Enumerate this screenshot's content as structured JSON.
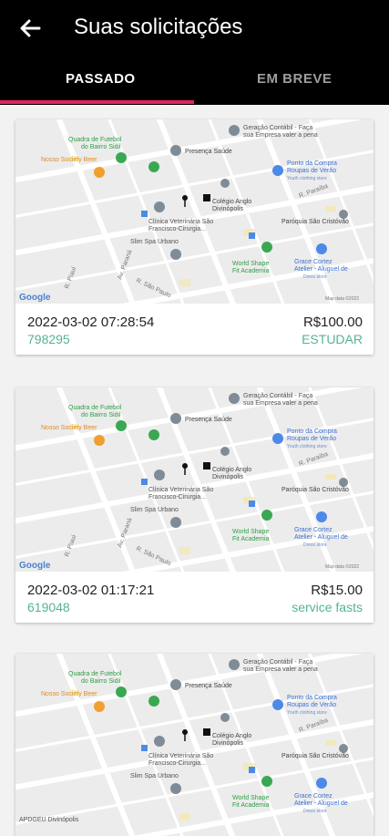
{
  "header": {
    "title": "Suas solicitações"
  },
  "tabs": [
    {
      "label": "PASSADO",
      "active": true
    },
    {
      "label": "EM BREVE",
      "active": false
    }
  ],
  "accent_color": "#e0245e",
  "code_color": "#55b48e",
  "map": {
    "labels": {
      "quadra1": "Quadra de Futebol",
      "quadra2": "do Bairro Sidil",
      "nosso": "Nosso Society Beer",
      "presenca": "Presença Saúde",
      "geracao1": "Geração Contábil - Faça",
      "geracao2": "sua Empresa valer a pena",
      "ponto1": "Ponto da Compra",
      "ponto2": "Roupas de Verão",
      "ponto3": "Youth clothing store",
      "colegio1": "Colégio Anglo",
      "colegio2": "Divinópolis",
      "clinica1": "Clínica Veterinária São",
      "clinica2": "Francisco-Cirurgia...",
      "slim": "Slim Spa Urbano",
      "paroquia": "Paróquia São Cristóvão",
      "world1": "World Shape",
      "world2": "Fit Academia",
      "grace1": "Grace Cortez",
      "grace2": "Atelier - Aluguel de",
      "grace3": "Dress store",
      "parana": "Av. Paraná",
      "saopaulo": "R. São Paulo",
      "piaui": "R. Piauí",
      "paraiba": "R. Paraíba",
      "google": "Google",
      "mapdata": "Map data ©2022",
      "apdgeu": "APDGEU Divinópolis"
    }
  },
  "requests": [
    {
      "date": "2022-03-02 07:28:54",
      "code": "798295",
      "price": "R$100.00",
      "service": "ESTUDAR"
    },
    {
      "date": "2022-03-02 01:17:21",
      "code": "619048",
      "price": "R$15.00",
      "service": "service fasts"
    },
    {
      "date": "",
      "code": "",
      "price": "",
      "service": ""
    }
  ]
}
